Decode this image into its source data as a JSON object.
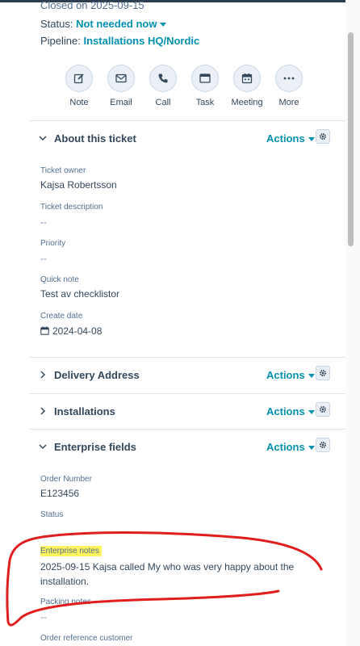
{
  "header": {
    "closed_on": "Closed on 2025-09-15",
    "status_label": "Status:",
    "status_value": "Not needed now",
    "pipeline_label": "Pipeline:",
    "pipeline_value": "Installations HQ/Nordic"
  },
  "activity_actions": [
    {
      "label": "Note",
      "icon": "note-icon"
    },
    {
      "label": "Email",
      "icon": "email-icon"
    },
    {
      "label": "Call",
      "icon": "phone-icon"
    },
    {
      "label": "Task",
      "icon": "task-icon"
    },
    {
      "label": "Meeting",
      "icon": "calendar-icon"
    },
    {
      "label": "More",
      "icon": "more-icon"
    }
  ],
  "sections": {
    "about": {
      "title": "About this ticket",
      "actions_label": "Actions",
      "fields": {
        "ticket_owner": {
          "label": "Ticket owner",
          "value": "Kajsa Robertsson"
        },
        "ticket_description": {
          "label": "Ticket description",
          "value": "--"
        },
        "priority": {
          "label": "Priority",
          "value": "--"
        },
        "quick_note": {
          "label": "Quick note",
          "value": "Test av checklistor"
        },
        "create_date": {
          "label": "Create date",
          "value": "2024-04-08"
        }
      }
    },
    "delivery": {
      "title": "Delivery Address",
      "actions_label": "Actions"
    },
    "installations": {
      "title": "Installations",
      "actions_label": "Actions"
    },
    "enterprise": {
      "title": "Enterprise fields",
      "actions_label": "Actions",
      "fields": {
        "order_number": {
          "label": "Order Number",
          "value": "E123456"
        },
        "status": {
          "label": "Status",
          "value": ""
        },
        "enterprise_notes": {
          "label": "Enterprise notes",
          "value": "2025-09-15 Kajsa called My who was very happy about the installation."
        },
        "packing_notes": {
          "label": "Packing notes",
          "value": "--"
        },
        "order_reference_customer": {
          "label": "Order reference customer"
        }
      }
    }
  },
  "colors": {
    "accent": "#0091ae",
    "text": "#33475b",
    "highlight": "#fff45c",
    "annotation": "#e01e1e"
  }
}
